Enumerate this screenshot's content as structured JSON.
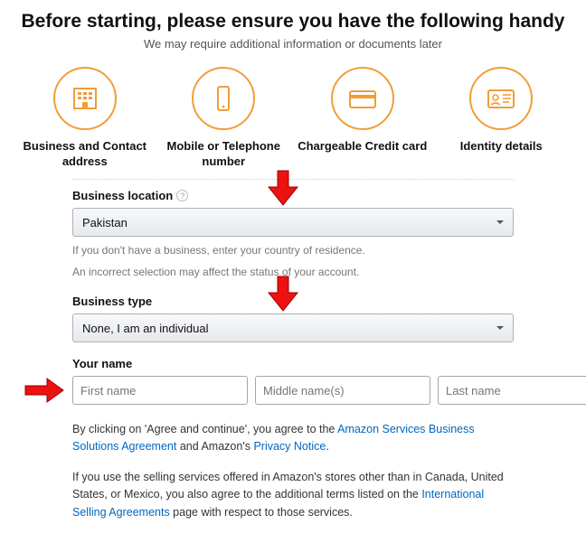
{
  "header": {
    "title": "Before starting, please ensure you have the following handy",
    "subtitle": "We may require additional information or documents later"
  },
  "icons": {
    "business_address": "Business and Contact address",
    "mobile": "Mobile or Telephone number",
    "credit_card": "Chargeable Credit card",
    "identity": "Identity details"
  },
  "form": {
    "business_location": {
      "label": "Business location",
      "value": "Pakistan",
      "hint1": "If you don't have a business, enter your country of residence.",
      "hint2": "An incorrect selection may affect the status of your account."
    },
    "business_type": {
      "label": "Business type",
      "value": "None, I am an individual"
    },
    "your_name": {
      "label": "Your name",
      "first_placeholder": "First name",
      "middle_placeholder": "Middle name(s)",
      "last_placeholder": "Last name"
    }
  },
  "legal": {
    "agree_prefix": "By clicking on 'Agree and continue', you agree to the ",
    "agree_link1": "Amazon Services Business Solutions Agreement",
    "agree_mid": " and Amazon's ",
    "agree_link2": "Privacy Notice",
    "agree_suffix": ".",
    "intl_prefix": "If you use the selling services offered in Amazon's stores other than in Canada, United States, or Mexico, you also agree to the additional terms listed on the ",
    "intl_link": "International Selling Agreements",
    "intl_suffix": " page with respect to those services."
  }
}
